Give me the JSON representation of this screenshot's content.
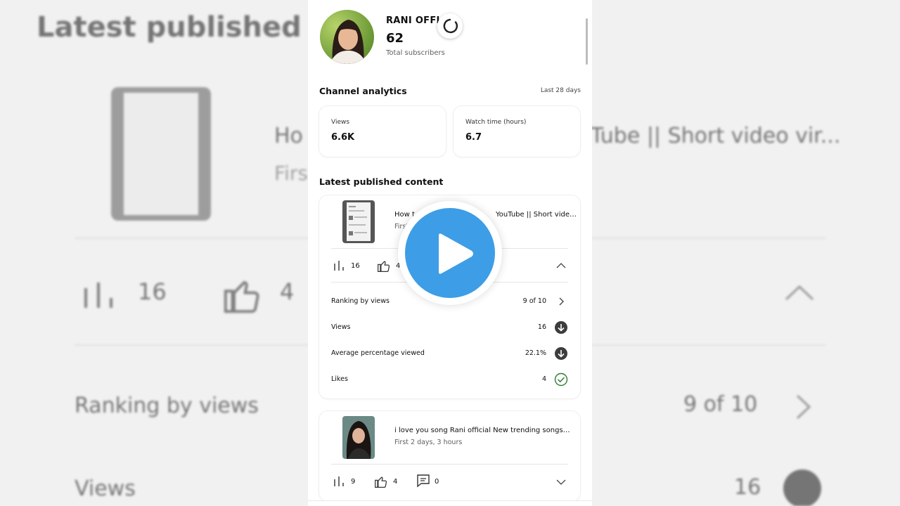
{
  "background": {
    "title": "Latest published cont",
    "video_title_left": "Ho",
    "video_title_right": "Tube || Short video vir...",
    "video_sub": "Firs",
    "views": "16",
    "likes": "4",
    "ranking_label": "Ranking by views",
    "ranking_value": "9 of 10",
    "views_label": "Views",
    "views_value": "16"
  },
  "channel": {
    "name": "RANI OFFICI",
    "subscribers": "62",
    "subscribers_label": "Total subscribers"
  },
  "analytics": {
    "title": "Channel analytics",
    "period": "Last 28 days",
    "cards": [
      {
        "label": "Views",
        "value": "6.6K"
      },
      {
        "label": "Watch time (hours)",
        "value": "6.7"
      }
    ]
  },
  "latest": {
    "title": "Latest published content",
    "videos": [
      {
        "title": "How t... YouTube || Short video vir...",
        "title_left": "How t",
        "title_right": "YouTube || Short video vir...",
        "subtitle": "First",
        "views": "16",
        "likes": "4",
        "details": [
          {
            "label": "Ranking by views",
            "value": "9 of 10",
            "icon": "chevron-right-icon"
          },
          {
            "label": "Views",
            "value": "16",
            "icon": "arrow-down-circle-icon"
          },
          {
            "label": "Average percentage viewed",
            "value": "22.1%",
            "icon": "arrow-down-circle-icon"
          },
          {
            "label": "Likes",
            "value": "4",
            "icon": "check-circle-icon"
          }
        ]
      },
      {
        "title": "i love you song Rani official New trending songs shor...",
        "subtitle": "First 2 days, 3 hours",
        "views": "9",
        "likes": "4",
        "comments": "0"
      }
    ]
  },
  "colors": {
    "accent": "#3d9de6",
    "check": "#2e7d32",
    "dark_icon": "#3c3c3c"
  }
}
